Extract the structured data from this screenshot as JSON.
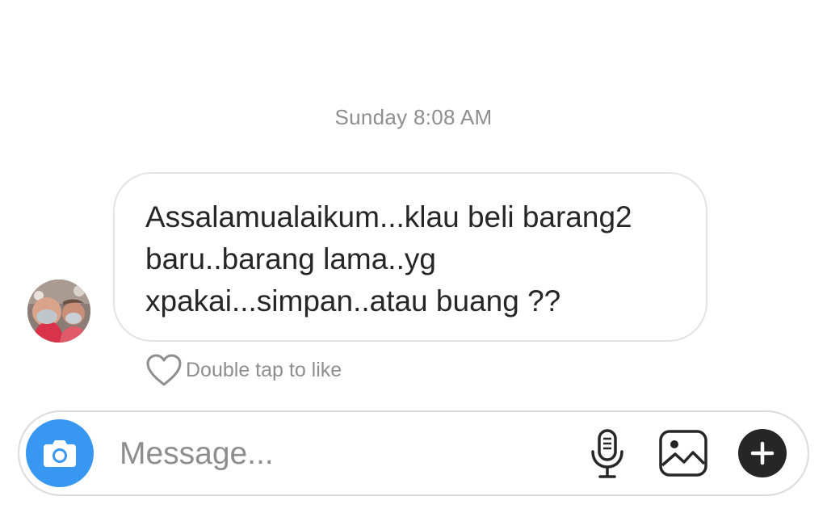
{
  "thread": {
    "timestamp": "Sunday 8:08 AM"
  },
  "message": {
    "lines": [
      "Assalamualaikum...klau beli barang2",
      "baru..barang lama..yg",
      "xpakai...simpan..atau buang ??"
    ],
    "like_hint": "Double tap to like"
  },
  "composer": {
    "placeholder": "Message..."
  },
  "icons": {
    "camera": "camera-icon",
    "microphone": "microphone-icon",
    "gallery": "gallery-icon",
    "plus": "plus-icon",
    "heart": "heart-icon"
  },
  "colors": {
    "camera_accent": "#3897f0",
    "text_primary": "#262626",
    "text_secondary": "#8e8e8e"
  }
}
